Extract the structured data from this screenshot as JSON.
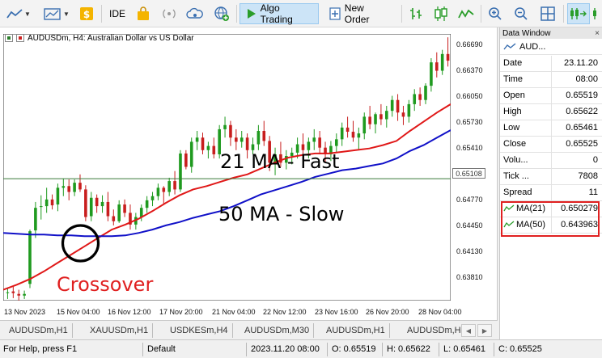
{
  "toolbar": {
    "ide_label": "IDE",
    "algo_trading_label": "Algo Trading",
    "new_order_label": "New Order"
  },
  "chart": {
    "title": "AUDUSDm, H4:  Australian Dollar vs US Dollar",
    "price_labels": [
      "0.66690",
      "0.66370",
      "0.66050",
      "0.65730",
      "0.65410",
      "0.65108",
      "0.64770",
      "0.64450",
      "0.64130",
      "0.63810"
    ],
    "time_labels": [
      "13 Nov 2023",
      "15 Nov 04:00",
      "16 Nov 12:00",
      "17 Nov 20:00",
      "21 Nov 04:00",
      "22 Nov 12:00",
      "23 Nov 16:00",
      "26 Nov 20:00",
      "28 Nov 04:00"
    ],
    "annotation_fast": "21 MA - Fast",
    "annotation_slow": "50 MA - Slow",
    "annotation_crossover": "Crossover",
    "colors": {
      "fast_ma": "#e01818",
      "slow_ma": "#1010c8",
      "bull": "#1f9a1f",
      "bear": "#c81e1e",
      "hline": "#3a7a3a",
      "highlight": "#e02020"
    }
  },
  "chart_data": {
    "type": "line",
    "title": "AUDUSDm, H4:  Australian Dollar vs US Dollar",
    "ylim": [
      0.6365,
      0.6684
    ],
    "horizontal_line": 0.65108,
    "series": [
      {
        "name": "MA(21)",
        "values": [
          0.6378,
          0.6384,
          0.6391,
          0.64,
          0.641,
          0.642,
          0.643,
          0.644,
          0.645,
          0.6456,
          0.6463,
          0.6472,
          0.6482,
          0.6491,
          0.6498,
          0.6502,
          0.6507,
          0.6512,
          0.6516,
          0.6523,
          0.653,
          0.6536,
          0.6539,
          0.6541,
          0.6541,
          0.6543,
          0.6545,
          0.6547,
          0.6551,
          0.6556,
          0.6568,
          0.6579,
          0.659,
          0.66
        ]
      },
      {
        "name": "MA(50)",
        "values": [
          0.6446,
          0.6445,
          0.6444,
          0.6444,
          0.6443,
          0.6443,
          0.6442,
          0.6442,
          0.6442,
          0.6443,
          0.6446,
          0.645,
          0.6455,
          0.6459,
          0.6464,
          0.6468,
          0.6472,
          0.6478,
          0.6485,
          0.6492,
          0.6497,
          0.6502,
          0.6507,
          0.6513,
          0.6517,
          0.6521,
          0.6523,
          0.6526,
          0.6529,
          0.6535,
          0.6544,
          0.6551,
          0.656,
          0.6569
        ]
      }
    ],
    "candles": [
      [
        0.6375,
        0.638,
        0.6367,
        0.6375
      ],
      [
        0.6376,
        0.6382,
        0.6368,
        0.6374
      ],
      [
        0.6373,
        0.6378,
        0.6365,
        0.6371
      ],
      [
        0.6371,
        0.6377,
        0.6367,
        0.6373
      ],
      [
        0.6385,
        0.645,
        0.638,
        0.6448
      ],
      [
        0.6449,
        0.6483,
        0.644,
        0.6476
      ],
      [
        0.6477,
        0.6491,
        0.6462,
        0.6478
      ],
      [
        0.6478,
        0.65,
        0.647,
        0.6486
      ],
      [
        0.6486,
        0.6492,
        0.6474,
        0.6479
      ],
      [
        0.648,
        0.6505,
        0.6472,
        0.65
      ],
      [
        0.65,
        0.6511,
        0.649,
        0.6502
      ],
      [
        0.6502,
        0.651,
        0.6485,
        0.6495
      ],
      [
        0.6495,
        0.651,
        0.649,
        0.6506
      ],
      [
        0.6506,
        0.6516,
        0.6495,
        0.6498
      ],
      [
        0.6498,
        0.6503,
        0.646,
        0.6465
      ],
      [
        0.6466,
        0.6495,
        0.646,
        0.6488
      ],
      [
        0.6488,
        0.6492,
        0.647,
        0.6478
      ],
      [
        0.6478,
        0.6491,
        0.647,
        0.6483
      ],
      [
        0.6483,
        0.6495,
        0.646,
        0.6466
      ],
      [
        0.6466,
        0.6474,
        0.6455,
        0.646
      ],
      [
        0.646,
        0.6485,
        0.6458,
        0.648
      ],
      [
        0.648,
        0.6486,
        0.6465,
        0.647
      ],
      [
        0.647,
        0.648,
        0.645,
        0.6456
      ],
      [
        0.6456,
        0.647,
        0.645,
        0.6465
      ],
      [
        0.6465,
        0.648,
        0.646,
        0.6476
      ],
      [
        0.6476,
        0.649,
        0.647,
        0.6485
      ],
      [
        0.6485,
        0.6495,
        0.6478,
        0.649
      ],
      [
        0.649,
        0.6505,
        0.6485,
        0.65
      ],
      [
        0.65,
        0.6502,
        0.648,
        0.6495
      ],
      [
        0.6495,
        0.6512,
        0.649,
        0.6508
      ],
      [
        0.6508,
        0.652,
        0.6492,
        0.6498
      ],
      [
        0.6498,
        0.6545,
        0.6495,
        0.6541
      ],
      [
        0.6541,
        0.6545,
        0.6522,
        0.6525
      ],
      [
        0.6525,
        0.656,
        0.6518,
        0.6555
      ],
      [
        0.6555,
        0.6568,
        0.6545,
        0.656
      ],
      [
        0.656,
        0.6566,
        0.654,
        0.6545
      ],
      [
        0.6545,
        0.6555,
        0.6535,
        0.655
      ],
      [
        0.655,
        0.656,
        0.6535,
        0.654
      ],
      [
        0.654,
        0.6575,
        0.6535,
        0.657
      ],
      [
        0.657,
        0.6585,
        0.656,
        0.6575
      ],
      [
        0.6575,
        0.658,
        0.655,
        0.656
      ],
      [
        0.656,
        0.657,
        0.6545,
        0.6555
      ],
      [
        0.6555,
        0.6568,
        0.6548,
        0.656
      ],
      [
        0.656,
        0.6565,
        0.6535,
        0.6545
      ],
      [
        0.6545,
        0.656,
        0.654,
        0.6552
      ],
      [
        0.6552,
        0.6575,
        0.6545,
        0.6568
      ],
      [
        0.6568,
        0.658,
        0.655,
        0.6556
      ],
      [
        0.6556,
        0.6562,
        0.652,
        0.653
      ],
      [
        0.653,
        0.6548,
        0.6515,
        0.654
      ],
      [
        0.654,
        0.6555,
        0.6525,
        0.653
      ],
      [
        0.653,
        0.6545,
        0.6522,
        0.6538
      ],
      [
        0.6538,
        0.6548,
        0.6528,
        0.6542
      ],
      [
        0.6542,
        0.656,
        0.6535,
        0.6552
      ],
      [
        0.6552,
        0.6565,
        0.654,
        0.6545
      ],
      [
        0.6545,
        0.656,
        0.6535,
        0.6555
      ],
      [
        0.6555,
        0.657,
        0.6545,
        0.656
      ],
      [
        0.656,
        0.6568,
        0.654,
        0.6548
      ],
      [
        0.6548,
        0.6555,
        0.653,
        0.654
      ],
      [
        0.654,
        0.6556,
        0.6532,
        0.655
      ],
      [
        0.655,
        0.6565,
        0.6542,
        0.6558
      ],
      [
        0.6558,
        0.6578,
        0.655,
        0.6572
      ],
      [
        0.6572,
        0.6585,
        0.656,
        0.6567
      ],
      [
        0.6567,
        0.658,
        0.6555,
        0.656
      ],
      [
        0.656,
        0.6572,
        0.6545,
        0.6565
      ],
      [
        0.6565,
        0.659,
        0.6558,
        0.6585
      ],
      [
        0.6585,
        0.6598,
        0.657,
        0.6576
      ],
      [
        0.6576,
        0.659,
        0.6565,
        0.6588
      ],
      [
        0.6588,
        0.66,
        0.6575,
        0.6582
      ],
      [
        0.6582,
        0.6598,
        0.6572,
        0.6592
      ],
      [
        0.6592,
        0.661,
        0.6585,
        0.6605
      ],
      [
        0.6605,
        0.6612,
        0.658,
        0.659
      ],
      [
        0.659,
        0.6598,
        0.6575,
        0.6585
      ],
      [
        0.6585,
        0.6605,
        0.6578,
        0.66
      ],
      [
        0.66,
        0.6618,
        0.6592,
        0.6612
      ],
      [
        0.6612,
        0.662,
        0.6598,
        0.6605
      ],
      [
        0.6605,
        0.6625,
        0.66,
        0.6622
      ],
      [
        0.6622,
        0.6655,
        0.6615,
        0.665
      ],
      [
        0.665,
        0.6662,
        0.6632,
        0.664
      ],
      [
        0.664,
        0.6665,
        0.6635,
        0.666
      ],
      [
        0.666,
        0.668,
        0.6645,
        0.6652
      ]
    ]
  },
  "data_window": {
    "header": "Data Window",
    "close_glyph": "×",
    "symbol": "AUD...",
    "rows": [
      {
        "key": "Date",
        "value": "23.11.20"
      },
      {
        "key": "Time",
        "value": "08:00"
      },
      {
        "key": "Open",
        "value": "0.65519"
      },
      {
        "key": "High",
        "value": "0.65622"
      },
      {
        "key": "Low",
        "value": "0.65461"
      },
      {
        "key": "Close",
        "value": "0.65525"
      },
      {
        "key": "Volu...",
        "value": "0"
      },
      {
        "key": "Tick ...",
        "value": "7808"
      },
      {
        "key": "Spread",
        "value": "11"
      },
      {
        "key": "MA(21)",
        "value": "0.650279"
      },
      {
        "key": "MA(50)",
        "value": "0.643963"
      }
    ]
  },
  "tabs": [
    "AUDUSDm,H1",
    "XAUUSDm,H1",
    "USDKESm,H4",
    "AUDUSDm,M30",
    "AUDUSDm,H1",
    "AUDUSDm,H4"
  ],
  "status": {
    "help": "For Help, press F1",
    "profile": "Default",
    "datetime": "2023.11.20 08:00",
    "open": "O: 0.65519",
    "high": "H: 0.65622",
    "low": "L: 0.65461",
    "close": "C: 0.65525"
  }
}
